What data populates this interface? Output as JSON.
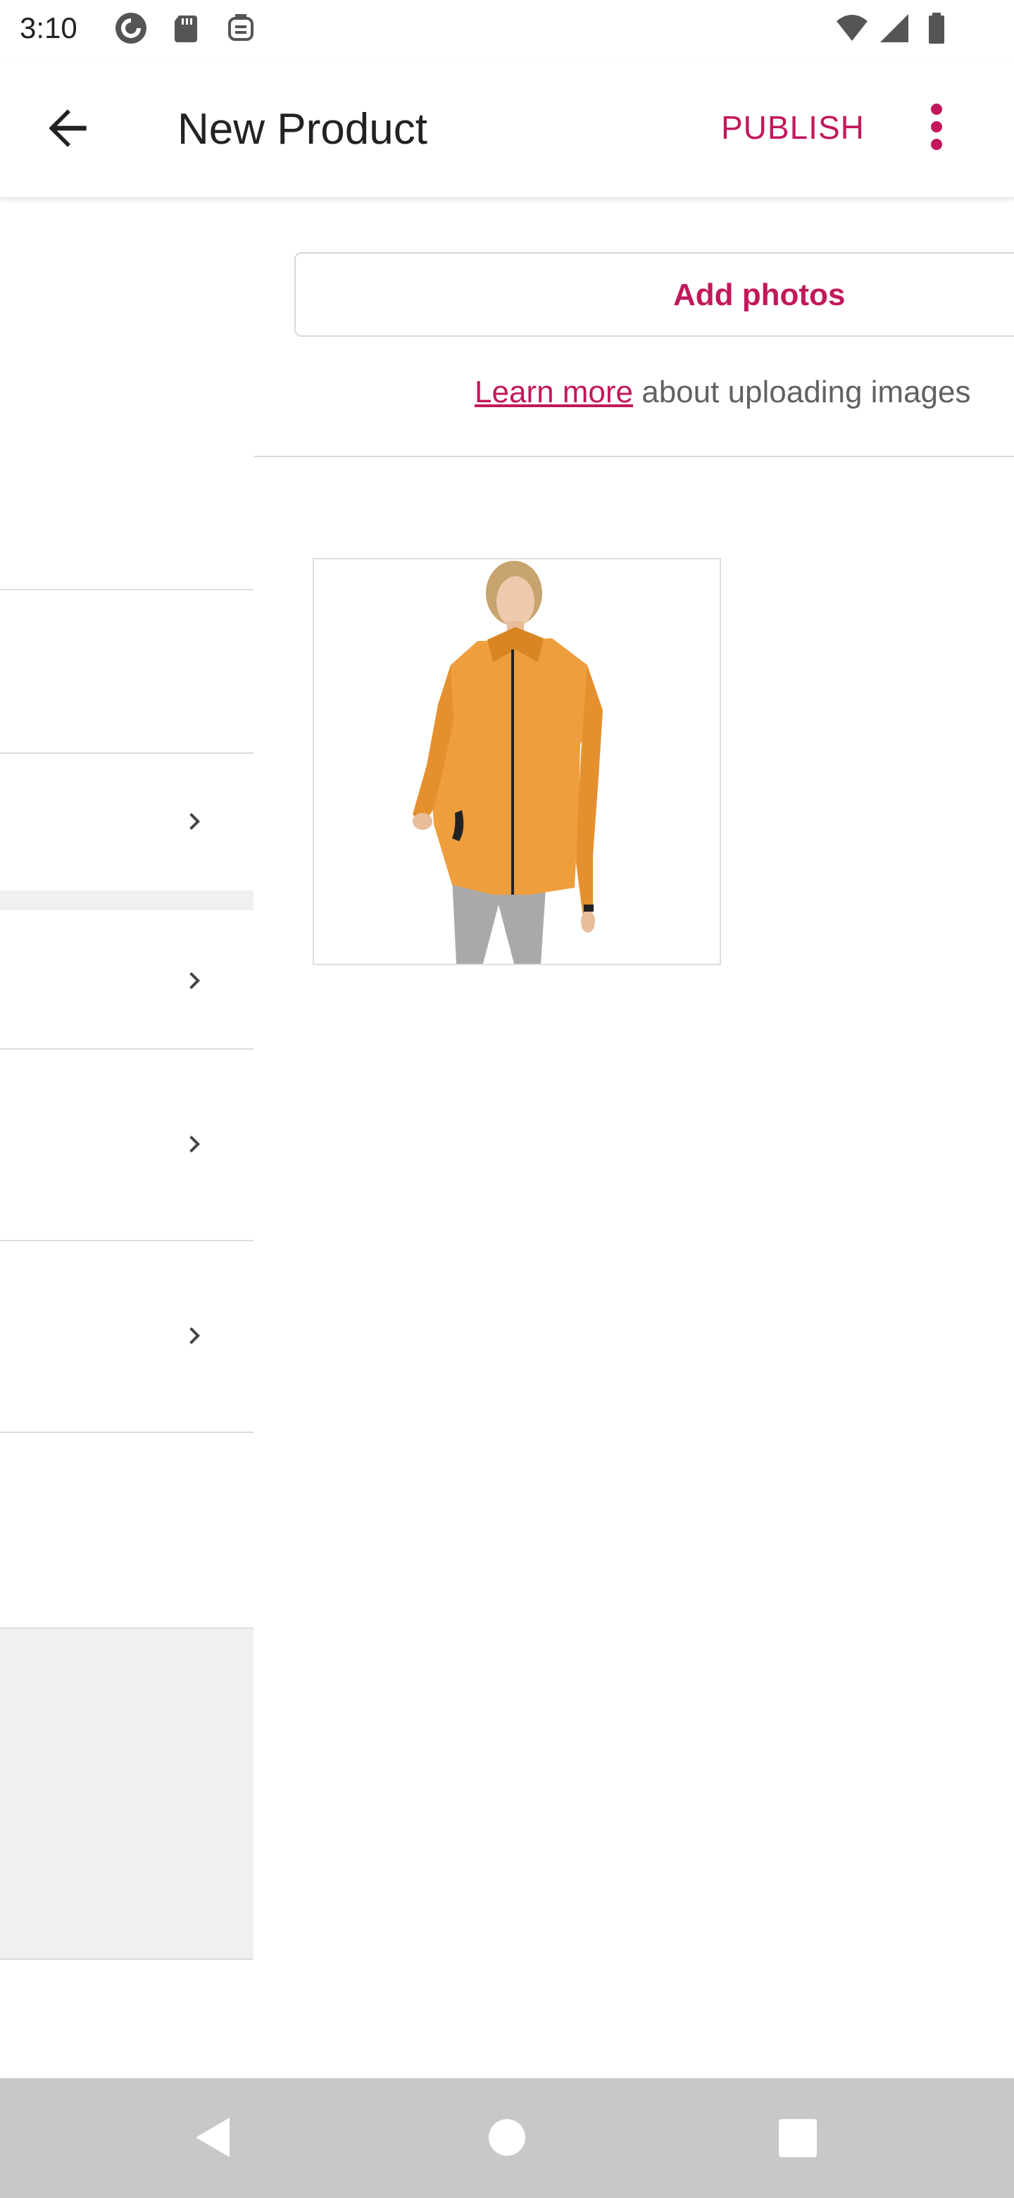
{
  "status_bar": {
    "time": "3:10",
    "left_icons": [
      "pocket-casts-icon",
      "sd-card-icon",
      "battery-saver-icon"
    ],
    "right_icons": [
      "wifi-icon",
      "cell-signal-icon",
      "battery-icon"
    ]
  },
  "app_bar": {
    "title": "New Product",
    "publish_label": "PUBLISH",
    "back_icon": "arrow-back-icon",
    "more_icon": "more-vert-icon"
  },
  "media": {
    "add_photos_label": "Add photos",
    "learn_more_link": "Learn more",
    "learn_more_rest": " about uploading images",
    "photo_icon": "orange-jacket-photo"
  },
  "nav_bar": {
    "icons": [
      "back-triangle-icon",
      "home-circle-icon",
      "recents-square-icon"
    ]
  },
  "colors": {
    "accent": "#c2185b",
    "divider": "#dcdcdc",
    "gray_block": "#f0f0f0",
    "nav_bar": "#c8c8c8",
    "jacket": "#f0a040"
  }
}
